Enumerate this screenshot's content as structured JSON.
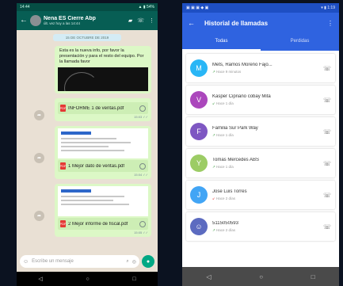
{
  "whatsapp": {
    "status_time": "14:44",
    "status_icons": "▲ ▮ 54%",
    "contact_name": "Nena ES Cierre Abp",
    "contact_sub": "últ. vez hoy a las 14:44",
    "date_chip": "15 DE OCTUBRE DE 2019",
    "message_text": "Esta es la nueva info, por favor la presentación y para el resto del equipo. Por la llamada favor",
    "docs": [
      {
        "name": "INFORME 1 de ventas.pdf",
        "meta": "15:03 ✓✓"
      },
      {
        "name": "1 Mejor dato de ventas.pdf",
        "meta": "15:04 ✓✓"
      },
      {
        "name": "2 Mejor informe de fiscal.pdf",
        "meta": "15:05 ✓✓"
      }
    ],
    "input_placeholder": "Escribe un mensaje"
  },
  "call_history": {
    "status_time": "1:19",
    "status_icons": "▾ ▮ 1:19",
    "title": "Historial de llamadas",
    "tabs": [
      "Todas",
      "Perdidas"
    ],
    "active_tab": 0,
    "items": [
      {
        "initial": "M",
        "color": "#29b6f6",
        "name": "Mets, Ramos Moreno Fajo...",
        "detail": "Hace 9 minutos",
        "arrow": "↗",
        "arrow_color": "#43a047"
      },
      {
        "initial": "V",
        "color": "#ab47bc",
        "name": "Kasper Cipriano cobay Mita",
        "detail": "Hace 1 día",
        "arrow": "↙",
        "arrow_color": "#43a047"
      },
      {
        "initial": "F",
        "color": "#7e57c2",
        "name": "Familia Sur Park Way",
        "detail": "Hace 1 día",
        "arrow": "↗",
        "arrow_color": "#43a047"
      },
      {
        "initial": "Y",
        "color": "#9ccc65",
        "name": "Tomas Mercedes ABS",
        "detail": "Hace 1 día",
        "arrow": "↗",
        "arrow_color": "#43a047"
      },
      {
        "initial": "J",
        "color": "#42a5f5",
        "name": "Jose Luis Torres",
        "detail": "Hace 2 días",
        "arrow": "↙",
        "arrow_color": "#e53935"
      },
      {
        "initial": "",
        "color": "#5c6bc0",
        "name": "5115050593",
        "detail": "Hace 2 días",
        "arrow": "↗",
        "arrow_color": "#43a047"
      }
    ]
  },
  "icons": {
    "back": "←",
    "more": "⋮",
    "phone": "☏",
    "video": "▰",
    "mic": "●",
    "emoji": "☺",
    "clip": "⌕",
    "camera": "◎",
    "nav_back": "◁",
    "nav_home": "○",
    "nav_recent": "□"
  }
}
